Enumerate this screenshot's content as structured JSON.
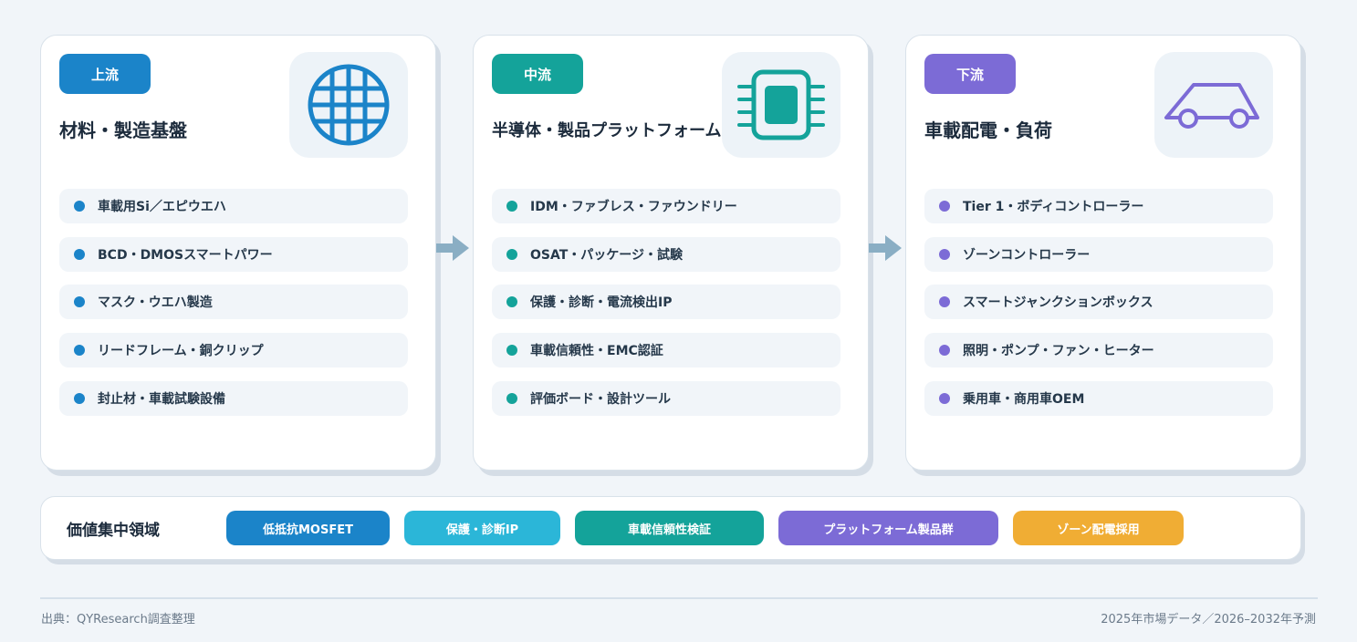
{
  "stages": [
    {
      "badge": "上流",
      "title": "材料・製造基盤",
      "color": "#1b84c9",
      "icon": "wafer-icon",
      "items": [
        "車載用Si／エピウエハ",
        "BCD・DMOSスマートパワー",
        "マスク・ウエハ製造",
        "リードフレーム・銅クリップ",
        "封止材・車載試験設備"
      ]
    },
    {
      "badge": "中流",
      "title": "半導体・製品プラットフォーム",
      "color": "#14a39a",
      "icon": "chip-icon",
      "items": [
        "IDM・ファブレス・ファウンドリー",
        "OSAT・パッケージ・試験",
        "保護・診断・電流検出IP",
        "車載信頼性・EMC認証",
        "評価ボード・設計ツール"
      ]
    },
    {
      "badge": "下流",
      "title": "車載配電・負荷",
      "color": "#7c6bd6",
      "icon": "car-icon",
      "items": [
        "Tier 1・ボディコントローラー",
        "ゾーンコントローラー",
        "スマートジャンクションボックス",
        "照明・ポンプ・ファン・ヒーター",
        "乗用車・商用車OEM"
      ]
    }
  ],
  "arrow_color": "#8aaec4",
  "value_area": {
    "title": "価値集中領域",
    "pills": [
      {
        "label": "低抵抗MOSFET",
        "color": "#1b84c9"
      },
      {
        "label": "保護・診断IP",
        "color": "#2bb6d8"
      },
      {
        "label": "車載信頼性検証",
        "color": "#14a39a"
      },
      {
        "label": "プラットフォーム製品群",
        "color": "#7c6bd6"
      },
      {
        "label": "ゾーン配電採用",
        "color": "#f0ad34"
      }
    ]
  },
  "footer": {
    "source": "出典：QYResearch調査整理",
    "note": "2025年市場データ／2026–2032年予測"
  }
}
